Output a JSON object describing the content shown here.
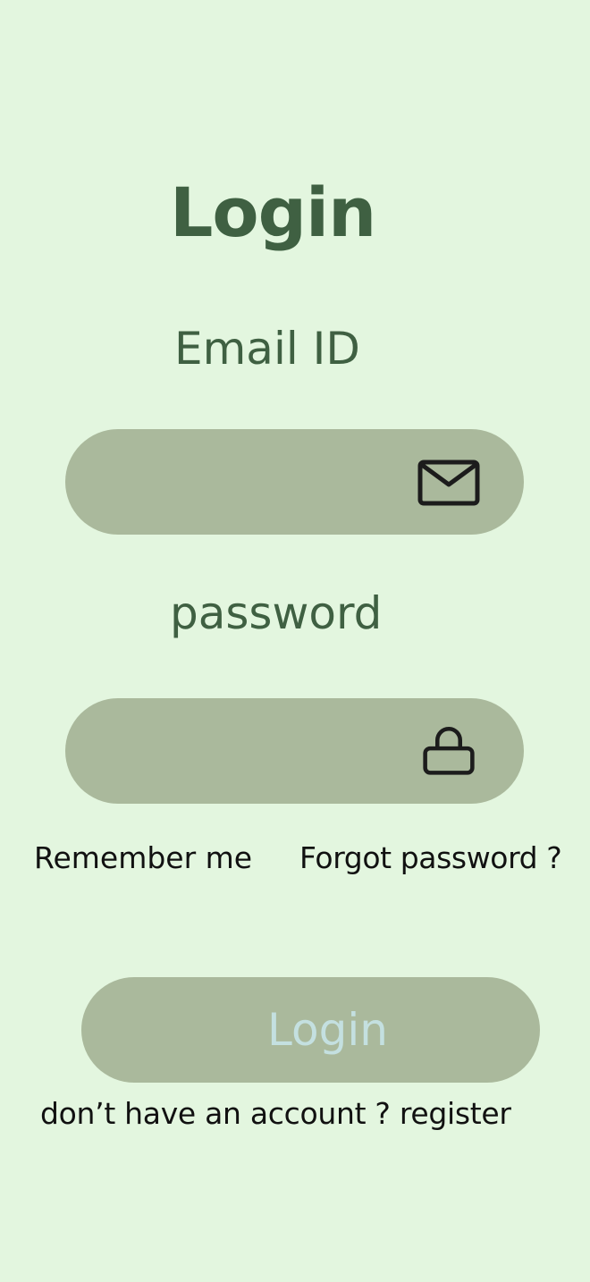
{
  "header": {
    "title": "Login"
  },
  "form": {
    "email_label": "Email ID",
    "email_value": "",
    "email_icon": "mail-icon",
    "password_label": "password",
    "password_value": "",
    "password_icon": "lock-icon",
    "remember_me": "Remember me",
    "forgot_password": "Forgot password ?",
    "submit_label": "Login"
  },
  "footer": {
    "prompt": "don’t have an account ? ",
    "register_link": "register"
  },
  "colors": {
    "background": "#e3f6df",
    "accent_text": "#3f6042",
    "field_fill": "#aab99c",
    "button_text": "#c4e0e0"
  }
}
